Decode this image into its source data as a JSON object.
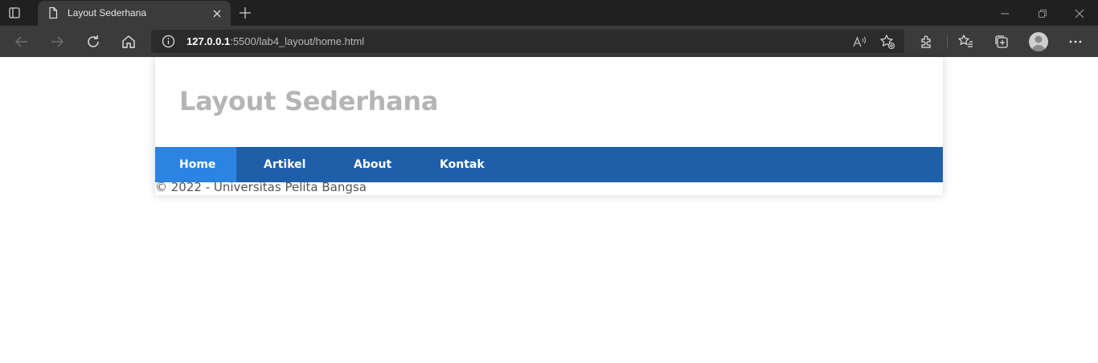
{
  "browser": {
    "tab": {
      "title": "Layout Sederhana"
    },
    "address_bar": {
      "host": "127.0.0.1",
      "rest": ":5500/lab4_layout/home.html"
    }
  },
  "page": {
    "title": "Layout Sederhana",
    "nav": [
      {
        "label": "Home",
        "active": true
      },
      {
        "label": "Artikel",
        "active": false
      },
      {
        "label": "About",
        "active": false
      },
      {
        "label": "Kontak",
        "active": false
      }
    ],
    "footer": "© 2022 - Universitas Pelita Bangsa"
  },
  "colors": {
    "nav_bg": "#1f5faa",
    "nav_active": "#2b83e2",
    "title": "#b5b5b5",
    "browser_dark": "#202020",
    "browser_toolbar": "#3b3b3b"
  }
}
